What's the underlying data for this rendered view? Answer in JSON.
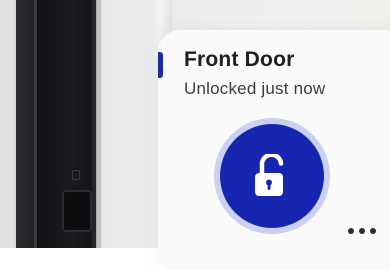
{
  "device": {
    "name": "Front Door",
    "status": "Unlocked just now",
    "lock_state": "unlocked"
  },
  "controls": {
    "toggle_icon": "unlocked-padlock-icon",
    "more_icon": "more-options-icon"
  },
  "colors": {
    "accent": "#1f2aa8",
    "button": "#1726b0",
    "button_ring": "#c9d2f2",
    "title_text": "#1d1e20",
    "status_text": "#3a3b3d"
  }
}
